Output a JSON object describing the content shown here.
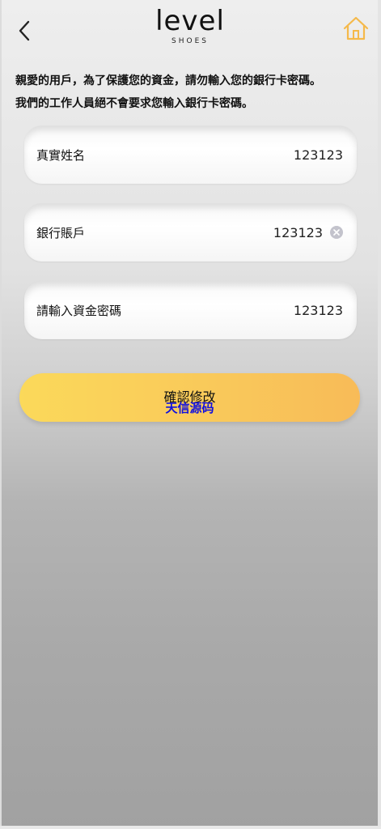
{
  "header": {
    "back_icon": "chevron-left-icon",
    "logo_main": "level",
    "logo_sub": "SHOES",
    "home_icon": "home-icon",
    "home_icon_color": "#f5b94a"
  },
  "notice": {
    "line1": "親愛的用戶，為了保護您的資金，請勿輸入您的銀行卡密碼。",
    "line2": "我們的工作人員絕不會要求您輸入銀行卡密碼。"
  },
  "form": {
    "fields": [
      {
        "label": "真實姓名",
        "value": "123123"
      },
      {
        "label": "銀行賬戶",
        "value": "123123",
        "clear_icon": "clear-icon"
      },
      {
        "label": "請輸入資金密碼",
        "value": "123123"
      }
    ]
  },
  "confirm": {
    "label": "確認修改",
    "watermark": "天信源码",
    "color_start": "#fbd95a",
    "color_end": "#f8bb58"
  }
}
